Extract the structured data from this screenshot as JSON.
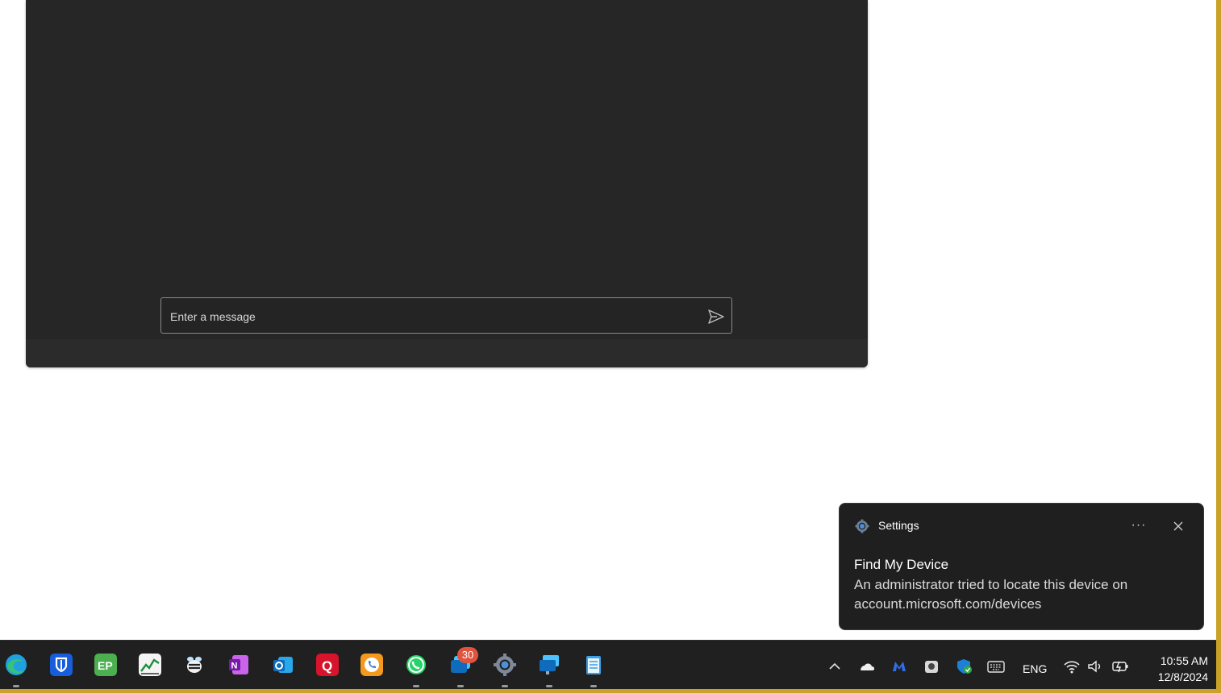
{
  "chat": {
    "message_placeholder": "Enter a message",
    "send_icon": "send-icon"
  },
  "notification": {
    "app_name": "Settings",
    "app_icon": "settings-gear-icon",
    "more_label": "···",
    "title": "Find My Device",
    "body": "An administrator tried to locate this device on account.microsoft.com/devices"
  },
  "taskbar": {
    "apps": [
      {
        "name": "Edge"
      },
      {
        "name": "Bitwarden"
      },
      {
        "name": "EP"
      },
      {
        "name": "Stock chart"
      },
      {
        "name": "Bee app"
      },
      {
        "name": "OneNote"
      },
      {
        "name": "Outlook"
      },
      {
        "name": "Q app"
      },
      {
        "name": "Phone"
      },
      {
        "name": "WhatsApp"
      },
      {
        "name": "Messages",
        "badge": "30"
      },
      {
        "name": "Settings"
      },
      {
        "name": "Remote desktop"
      },
      {
        "name": "Notepad"
      }
    ],
    "tray": {
      "language": "ENG",
      "time": "10:55 AM",
      "date": "12/8/2024"
    }
  }
}
